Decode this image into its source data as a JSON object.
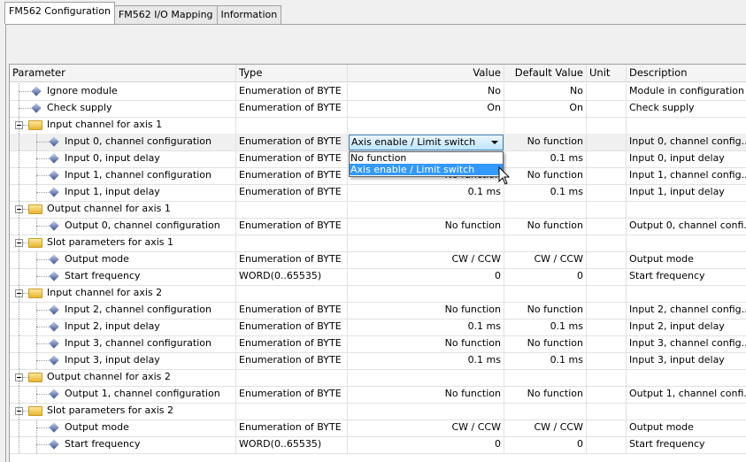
{
  "tabs": [
    {
      "label": "FM562 Configuration",
      "active": true
    },
    {
      "label": "FM562 I/O Mapping"
    },
    {
      "label": "Information"
    }
  ],
  "columns": [
    "Parameter",
    "Type",
    "Value",
    "Default Value",
    "Unit",
    "Description"
  ],
  "rows": [
    {
      "level": 1,
      "kind": "param",
      "name": "Ignore module",
      "type": "Enumeration of BYTE",
      "value": "No",
      "default": "No",
      "unit": "",
      "desc": "Module in configuration"
    },
    {
      "level": 1,
      "kind": "param",
      "name": "Check supply",
      "type": "Enumeration of BYTE",
      "value": "On",
      "default": "On",
      "unit": "",
      "desc": "Check supply"
    },
    {
      "level": 0,
      "kind": "folder",
      "name": "Input channel for axis 1"
    },
    {
      "level": 2,
      "kind": "param",
      "name": "Input 0, channel configuration",
      "type": "Enumeration of BYTE",
      "value": "",
      "default": "No function",
      "unit": "",
      "desc": "Input 0, channel config...",
      "selected": true
    },
    {
      "level": 2,
      "kind": "param",
      "name": "Input 0, input delay",
      "type": "Enumeration of BYTE",
      "value": "",
      "default": "0.1 ms",
      "unit": "",
      "desc": "Input 0, input delay"
    },
    {
      "level": 2,
      "kind": "param",
      "name": "Input 1, channel configuration",
      "type": "Enumeration of BYTE",
      "value": "No function",
      "default": "No function",
      "unit": "",
      "desc": "Input 1, channel config..."
    },
    {
      "level": 2,
      "kind": "param",
      "name": "Input 1, input delay",
      "type": "Enumeration of BYTE",
      "value": "0.1 ms",
      "default": "0.1 ms",
      "unit": "",
      "desc": "Input 1, input delay"
    },
    {
      "level": 0,
      "kind": "folder",
      "name": "Output channel for axis 1"
    },
    {
      "level": 2,
      "kind": "param",
      "name": "Output 0, channel configuration",
      "type": "Enumeration of BYTE",
      "value": "No function",
      "default": "No function",
      "unit": "",
      "desc": "Output 0, channel confi..."
    },
    {
      "level": 0,
      "kind": "folder",
      "name": "Slot parameters for axis 1"
    },
    {
      "level": 2,
      "kind": "param",
      "name": "Output mode",
      "type": "Enumeration of BYTE",
      "value": "CW / CCW",
      "default": "CW / CCW",
      "unit": "",
      "desc": "Output mode"
    },
    {
      "level": 2,
      "kind": "param",
      "name": "Start frequency",
      "type": "WORD(0..65535)",
      "value": "0",
      "default": "0",
      "unit": "",
      "desc": "Start frequency"
    },
    {
      "level": 0,
      "kind": "folder",
      "name": "Input channel for axis 2"
    },
    {
      "level": 2,
      "kind": "param",
      "name": "Input 2, channel configuration",
      "type": "Enumeration of BYTE",
      "value": "No function",
      "default": "No function",
      "unit": "",
      "desc": "Input 2, channel config..."
    },
    {
      "level": 2,
      "kind": "param",
      "name": "Input 2, input delay",
      "type": "Enumeration of BYTE",
      "value": "0.1 ms",
      "default": "0.1 ms",
      "unit": "",
      "desc": "Input 2, input delay"
    },
    {
      "level": 2,
      "kind": "param",
      "name": "Input 3, channel configuration",
      "type": "Enumeration of BYTE",
      "value": "No function",
      "default": "No function",
      "unit": "",
      "desc": "Input 3, channel config..."
    },
    {
      "level": 2,
      "kind": "param",
      "name": "Input 3, input delay",
      "type": "Enumeration of BYTE",
      "value": "0.1 ms",
      "default": "0.1 ms",
      "unit": "",
      "desc": "Input 3, input delay"
    },
    {
      "level": 0,
      "kind": "folder",
      "name": "Output channel for axis 2"
    },
    {
      "level": 2,
      "kind": "param",
      "name": "Output 1, channel configuration",
      "type": "Enumeration of BYTE",
      "value": "No function",
      "default": "No function",
      "unit": "",
      "desc": "Output 1, channel confi..."
    },
    {
      "level": 0,
      "kind": "folder",
      "name": "Slot parameters for axis 2"
    },
    {
      "level": 2,
      "kind": "param",
      "name": "Output mode",
      "type": "Enumeration of BYTE",
      "value": "CW / CCW",
      "default": "CW / CCW",
      "unit": "",
      "desc": "Output mode"
    },
    {
      "level": 2,
      "kind": "param",
      "name": "Start frequency",
      "type": "WORD(0..65535)",
      "value": "0",
      "default": "0",
      "unit": "",
      "desc": "Start frequency"
    }
  ],
  "dropdown": {
    "selected": "Axis enable / Limit switch",
    "options": [
      "No function",
      "Axis enable / Limit switch"
    ],
    "highlighted": 1
  },
  "colors": {
    "highlight": "#3399ff",
    "combo_border": "#3c7fb1"
  }
}
